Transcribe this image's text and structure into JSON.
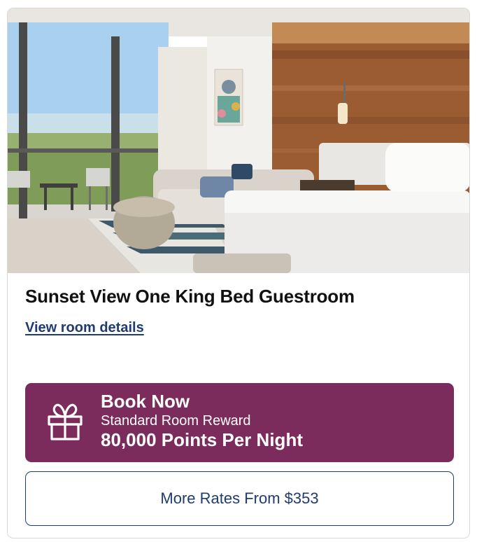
{
  "room": {
    "title": "Sunset View One King Bed Guestroom",
    "details_link": "View room details",
    "photo_icon": "hotel-room-photo"
  },
  "book": {
    "label": "Book Now",
    "subtitle": "Standard Room Reward",
    "points": "80,000 Points Per Night",
    "icon": "gift-icon",
    "color": "#7b2c5d"
  },
  "rates": {
    "label": "More Rates From $353",
    "color": "#1f3b70"
  }
}
